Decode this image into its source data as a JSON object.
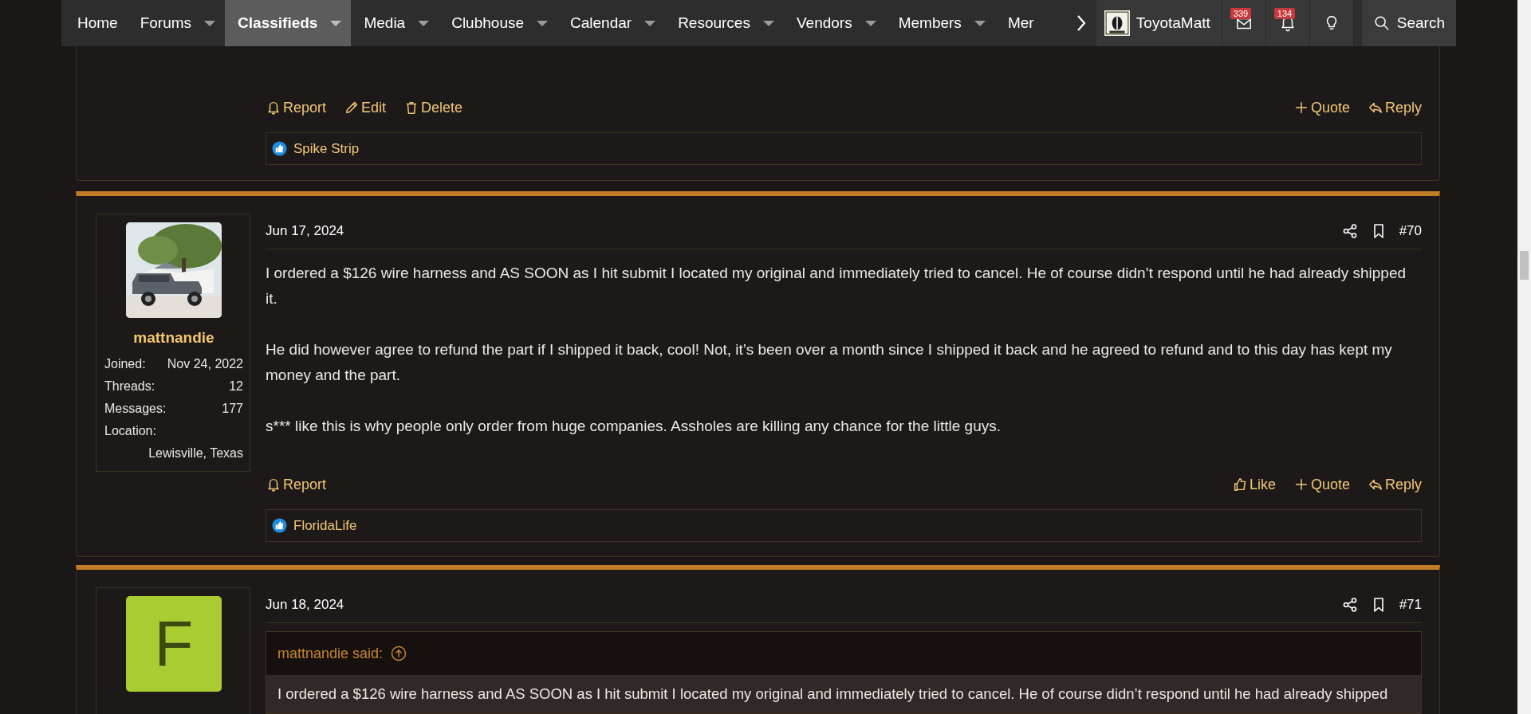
{
  "nav": {
    "items": [
      {
        "label": "Home",
        "selected": false,
        "dropdown": false
      },
      {
        "label": "Forums",
        "selected": false,
        "dropdown": true
      },
      {
        "label": "Classifieds",
        "selected": true,
        "dropdown": true
      },
      {
        "label": "Media",
        "selected": false,
        "dropdown": true
      },
      {
        "label": "Clubhouse",
        "selected": false,
        "dropdown": true
      },
      {
        "label": "Calendar",
        "selected": false,
        "dropdown": true
      },
      {
        "label": "Resources",
        "selected": false,
        "dropdown": true
      },
      {
        "label": "Vendors",
        "selected": false,
        "dropdown": true
      },
      {
        "label": "Members",
        "selected": false,
        "dropdown": true
      },
      {
        "label": "Mer",
        "selected": false,
        "dropdown": false
      }
    ],
    "user": "ToyotaMatt",
    "inbox_count": "339",
    "alerts_count": "134",
    "search": "Search"
  },
  "posts": [
    {
      "actions_left": [
        {
          "kind": "report",
          "label": "Report"
        },
        {
          "kind": "edit",
          "label": "Edit"
        },
        {
          "kind": "delete",
          "label": "Delete"
        }
      ],
      "actions_right": [
        {
          "kind": "quote",
          "label": "Quote"
        },
        {
          "kind": "reply",
          "label": "Reply"
        }
      ],
      "reactions": "Spike Strip"
    },
    {
      "author": {
        "name": "mattnandie",
        "stats": [
          {
            "label": "Joined:",
            "value": "Nov 24, 2022"
          },
          {
            "label": "Threads:",
            "value": "12"
          },
          {
            "label": "Messages:",
            "value": "177"
          }
        ],
        "location_label": "Location:",
        "location": "Lewisville, Texas"
      },
      "date": "Jun 17, 2024",
      "number": "#70",
      "paragraphs": [
        "I ordered a $126 wire harness and AS SOON as I hit submit I located my original and immediately tried to cancel. He of course didn’t respond until he had already shipped it.",
        "He did however agree to refund the part if I shipped it back, cool! Not, it’s been over a month since I shipped it back and he agreed to refund and to this day has kept my money and the part.",
        "s*** like this is why people only order from huge companies. Assholes are killing any chance for the little guys."
      ],
      "actions_left": [
        {
          "kind": "report",
          "label": "Report"
        }
      ],
      "actions_right": [
        {
          "kind": "like",
          "label": "Like"
        },
        {
          "kind": "quote",
          "label": "Quote"
        },
        {
          "kind": "reply",
          "label": "Reply"
        }
      ],
      "reactions": "FloridaLife"
    },
    {
      "author": {
        "avatar": {
          "kind": "letter",
          "letter": "F",
          "color": "#a9cc32"
        }
      },
      "date": "Jun 18, 2024",
      "number": "#71",
      "quote": {
        "author": "mattnandie said:",
        "text": "I ordered a $126 wire harness and AS SOON as I hit submit I located my original and immediately tried to cancel. He of course didn’t respond until he had already shipped"
      }
    }
  ]
}
